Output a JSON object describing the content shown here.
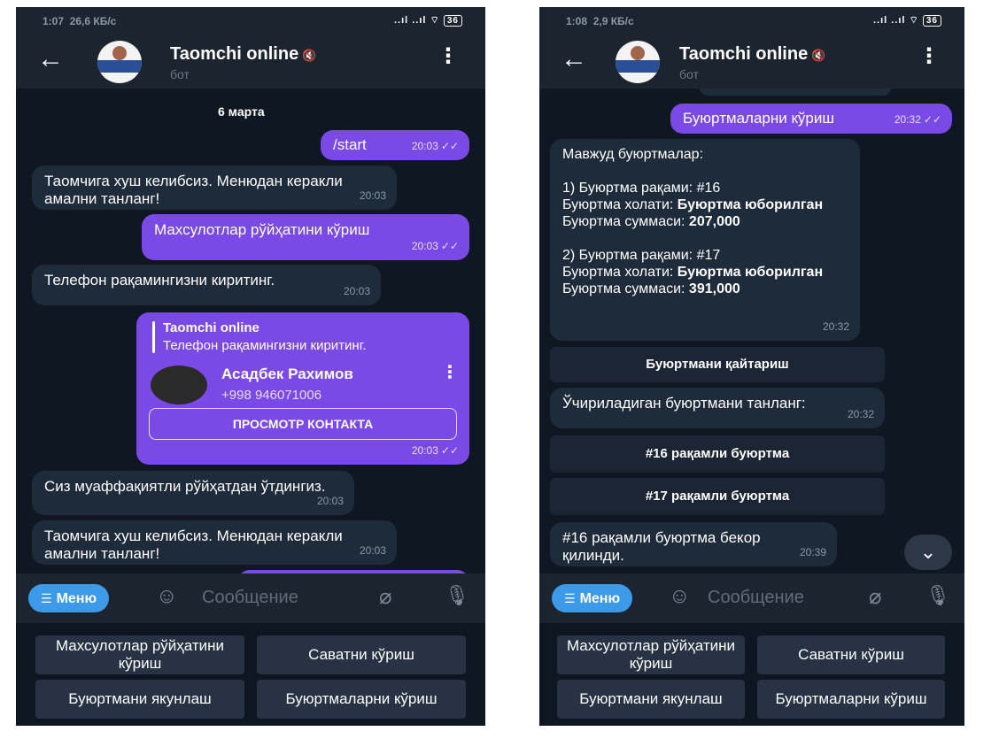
{
  "phone1": {
    "status": {
      "time": "1:07",
      "speed": "26,6 КБ/с",
      "signal": "..ıl ..ıl ⌔",
      "battery": "36"
    },
    "header": {
      "title": "Taomchi online",
      "subtitle": "бот"
    },
    "chat": {
      "date": "6 марта",
      "msgs": {
        "m1": {
          "text": "/start",
          "time": "20:03"
        },
        "m2": {
          "text": "Таомчига хуш келибсиз. Менюдан керакли амални танланг!",
          "time": "20:03"
        },
        "m3": {
          "text": "Махсулотлар рўйҳатини кўриш",
          "time": "20:03"
        },
        "m4": {
          "text": "Телефон рақамингизни киритинг.",
          "time": "20:03"
        },
        "m5": {
          "quote_title": "Taomchi online",
          "quote_text": "Телефон рақамингизни киритинг.",
          "name": "Асадбек Рахимов",
          "phone": "+998 946071006",
          "button": "ПРОСМОТР КОНТАКТА",
          "time": "20:03"
        },
        "m6": {
          "text": "Сиз муаффақиятли рўйҳатдан ўтдингиз.",
          "time": "20:03"
        },
        "m7": {
          "text": "Таомчига хуш келибсиз. Менюдан керакли амални танланг!",
          "time": "20:03"
        }
      }
    },
    "composer": {
      "menu_label": "Меню",
      "placeholder": "Сообщение"
    },
    "keyboard": {
      "b1": "Махсулотлар рўйҳатини кўриш",
      "b2": "Саватни кўриш",
      "b3": "Буюртмани якунлаш",
      "b4": "Буюртмаларни кўриш"
    }
  },
  "phone2": {
    "status": {
      "time": "1:08",
      "speed": "2,9 КБ/с",
      "signal": "..ıl ..ıl ⌔",
      "battery": "36"
    },
    "header": {
      "title": "Taomchi online",
      "subtitle": "бот"
    },
    "chat": {
      "msgs": {
        "m1": {
          "text": "Буюртмаларни кўриш",
          "time": "20:32"
        },
        "m2": {
          "heading": "Мавжуд буюртмалар:",
          "o1_num": "1) Буюртма рақами: #16",
          "o1_status_label": "Буюртма холати: ",
          "o1_status": "Буюртма юборилган",
          "o1_sum_label": "Буюртма суммаси: ",
          "o1_sum": "207,000",
          "o2_num": "2) Буюртма рақами: #17",
          "o2_status_label": "Буюртма холати: ",
          "o2_status": "Буюртма юборилган",
          "o2_sum_label": "Буюртма суммаси: ",
          "o2_sum": "391,000",
          "time": "20:32"
        },
        "m3_button": "Буюртмани қайтариш",
        "m4": {
          "text": "Ўчириладиган буюртмани танланг:",
          "time": "20:32"
        },
        "btn16": "#16 рақамли буюртма",
        "btn17": "#17 рақамли буюртма",
        "m5": {
          "text": "#16 рақамли буюртма бекор қилинди.",
          "time": "20:39"
        }
      }
    },
    "composer": {
      "menu_label": "Меню",
      "placeholder": "Сообщение"
    },
    "keyboard": {
      "b1": "Махсулотлар рўйҳатини кўриш",
      "b2": "Саватни кўриш",
      "b3": "Буюртмани якунлаш",
      "b4": "Буюртмаларни кўриш"
    }
  }
}
